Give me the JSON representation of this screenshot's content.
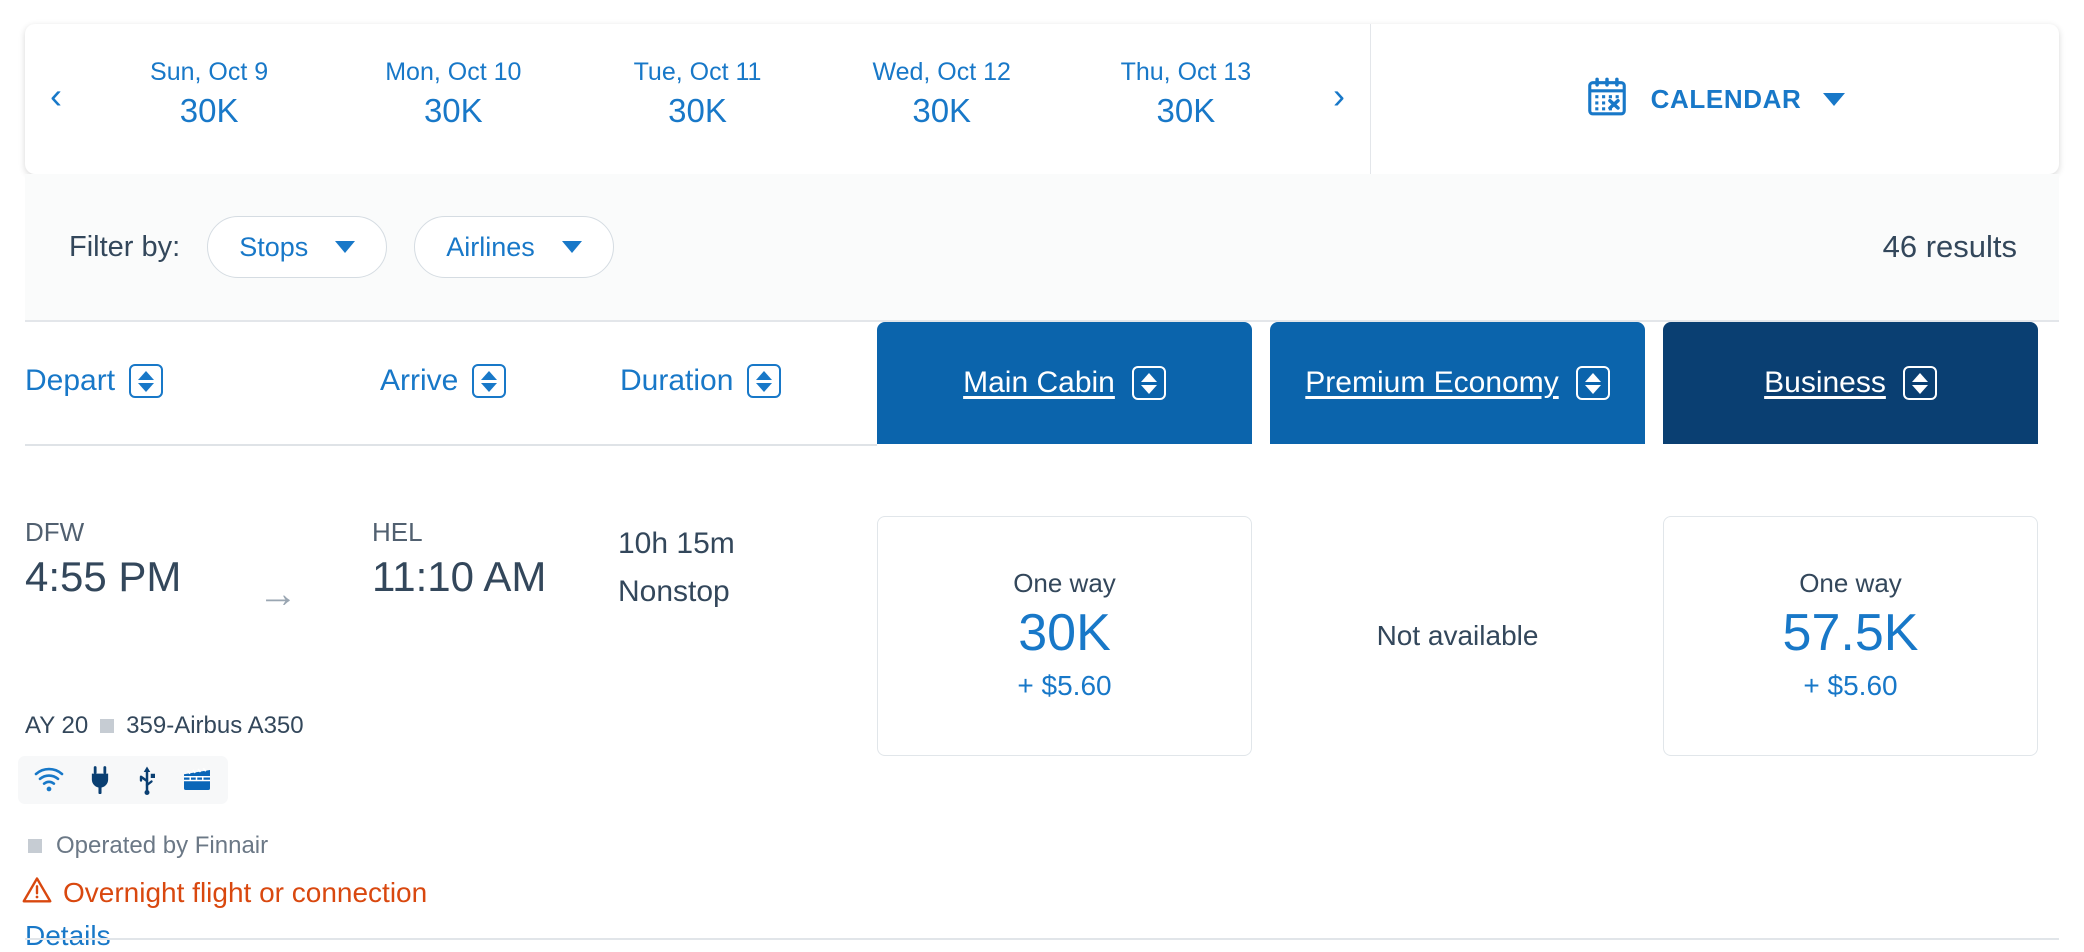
{
  "date_strip": {
    "prev_arrow": "‹",
    "next_arrow": "›",
    "tabs": [
      {
        "label": "Sun, Oct 9",
        "price": "30K",
        "selected": false
      },
      {
        "label": "Mon, Oct 10",
        "price": "30K",
        "selected": false
      },
      {
        "label": "Tue, Oct 11",
        "price": "30K",
        "selected": true
      },
      {
        "label": "Wed, Oct 12",
        "price": "30K",
        "selected": false
      },
      {
        "label": "Thu, Oct 13",
        "price": "30K",
        "selected": false
      }
    ],
    "calendar_icon": "calendar-icon",
    "calendar_label": "CALENDAR",
    "calendar_caret": "chevron-down-icon"
  },
  "filter_bar": {
    "label": "Filter by:",
    "filters": [
      {
        "label": "Stops"
      },
      {
        "label": "Airlines"
      }
    ],
    "results": "46 results"
  },
  "table": {
    "headers": {
      "depart": "Depart",
      "arrive": "Arrive",
      "duration": "Duration",
      "main_cabin": "Main Cabin",
      "premium_economy": "Premium Economy",
      "business": "Business"
    },
    "row": {
      "depart_airport": "DFW",
      "depart_time": "4:55 PM",
      "arrow": "→",
      "arrive_airport": "HEL",
      "arrive_time": "11:10 AM",
      "duration": "10h 15m",
      "stops": "Nonstop",
      "flight_number": "AY 20",
      "aircraft": "359-Airbus A350",
      "amenities": [
        "wifi-icon",
        "power-outlet-icon",
        "usb-port-icon",
        "entertainment-icon"
      ],
      "operated_by": "Operated by Finnair",
      "warning": "Overnight flight or connection",
      "details": "Details",
      "fares": {
        "main_cabin": {
          "type": "One way",
          "amount": "30K",
          "tax": "+ $5.60",
          "available": true
        },
        "premium_economy": {
          "unavailable_text": "Not available",
          "available": false
        },
        "business": {
          "type": "One way",
          "amount": "57.5K",
          "tax": "+ $5.60",
          "available": true
        }
      }
    }
  },
  "colors": {
    "brand_blue": "#1878c8",
    "cabin_header_blue": "#0b64ac",
    "business_header_navy": "#0a3f72",
    "warning_orange": "#d9480f",
    "text_dark": "#33475b"
  }
}
